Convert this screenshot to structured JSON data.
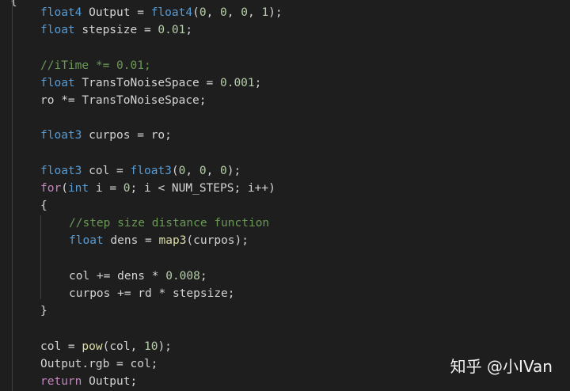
{
  "editor": {
    "top_brace": "{",
    "lines": [
      [
        {
          "t": "float4",
          "c": "kw"
        },
        {
          "t": " Output = ",
          "c": "id"
        },
        {
          "t": "float4",
          "c": "kw"
        },
        {
          "t": "(",
          "c": "op"
        },
        {
          "t": "0",
          "c": "num"
        },
        {
          "t": ", ",
          "c": "op"
        },
        {
          "t": "0",
          "c": "num"
        },
        {
          "t": ", ",
          "c": "op"
        },
        {
          "t": "0",
          "c": "num"
        },
        {
          "t": ", ",
          "c": "op"
        },
        {
          "t": "1",
          "c": "num"
        },
        {
          "t": ");",
          "c": "op"
        }
      ],
      [
        {
          "t": "float",
          "c": "kw"
        },
        {
          "t": " stepsize = ",
          "c": "id"
        },
        {
          "t": "0.01",
          "c": "num"
        },
        {
          "t": ";",
          "c": "op"
        }
      ],
      [],
      [
        {
          "t": "//iTime *= 0.01;",
          "c": "cmt"
        }
      ],
      [
        {
          "t": "float",
          "c": "kw"
        },
        {
          "t": " TransToNoiseSpace = ",
          "c": "id"
        },
        {
          "t": "0.001",
          "c": "num"
        },
        {
          "t": ";",
          "c": "op"
        }
      ],
      [
        {
          "t": "ro *= TransToNoiseSpace;",
          "c": "id"
        }
      ],
      [],
      [
        {
          "t": "float3",
          "c": "kw"
        },
        {
          "t": " curpos = ro;",
          "c": "id"
        }
      ],
      [],
      [
        {
          "t": "float3",
          "c": "kw"
        },
        {
          "t": " col = ",
          "c": "id"
        },
        {
          "t": "float3",
          "c": "kw"
        },
        {
          "t": "(",
          "c": "op"
        },
        {
          "t": "0",
          "c": "num"
        },
        {
          "t": ", ",
          "c": "op"
        },
        {
          "t": "0",
          "c": "num"
        },
        {
          "t": ", ",
          "c": "op"
        },
        {
          "t": "0",
          "c": "num"
        },
        {
          "t": ");",
          "c": "op"
        }
      ],
      [
        {
          "t": "for",
          "c": "ctl"
        },
        {
          "t": "(",
          "c": "op"
        },
        {
          "t": "int",
          "c": "kw"
        },
        {
          "t": " i = ",
          "c": "id"
        },
        {
          "t": "0",
          "c": "num"
        },
        {
          "t": "; i < NUM_STEPS; i++)",
          "c": "id"
        }
      ],
      [
        {
          "t": "{",
          "c": "op"
        }
      ],
      [
        {
          "t": "//step size distance function",
          "c": "cmt"
        }
      ],
      [
        {
          "t": "float",
          "c": "kw"
        },
        {
          "t": " dens = ",
          "c": "id"
        },
        {
          "t": "map3",
          "c": "fn"
        },
        {
          "t": "(curpos);",
          "c": "id"
        }
      ],
      [],
      [
        {
          "t": "col += dens * ",
          "c": "id"
        },
        {
          "t": "0.008",
          "c": "num"
        },
        {
          "t": ";",
          "c": "op"
        }
      ],
      [
        {
          "t": "curpos += rd * stepsize;",
          "c": "id"
        }
      ],
      [
        {
          "t": "}",
          "c": "op"
        }
      ],
      [],
      [
        {
          "t": "col = ",
          "c": "id"
        },
        {
          "t": "pow",
          "c": "fn"
        },
        {
          "t": "(col, ",
          "c": "id"
        },
        {
          "t": "10",
          "c": "num"
        },
        {
          "t": ");",
          "c": "op"
        }
      ],
      [
        {
          "t": "Output.rgb = col;",
          "c": "id"
        }
      ],
      [
        {
          "t": "return",
          "c": "ctl"
        },
        {
          "t": " Output;",
          "c": "id"
        }
      ]
    ],
    "indents": [
      1,
      1,
      0,
      1,
      1,
      1,
      0,
      1,
      0,
      1,
      1,
      1,
      2,
      2,
      0,
      2,
      2,
      1,
      0,
      1,
      1,
      1
    ]
  },
  "watermark": "知乎 @小IVan"
}
